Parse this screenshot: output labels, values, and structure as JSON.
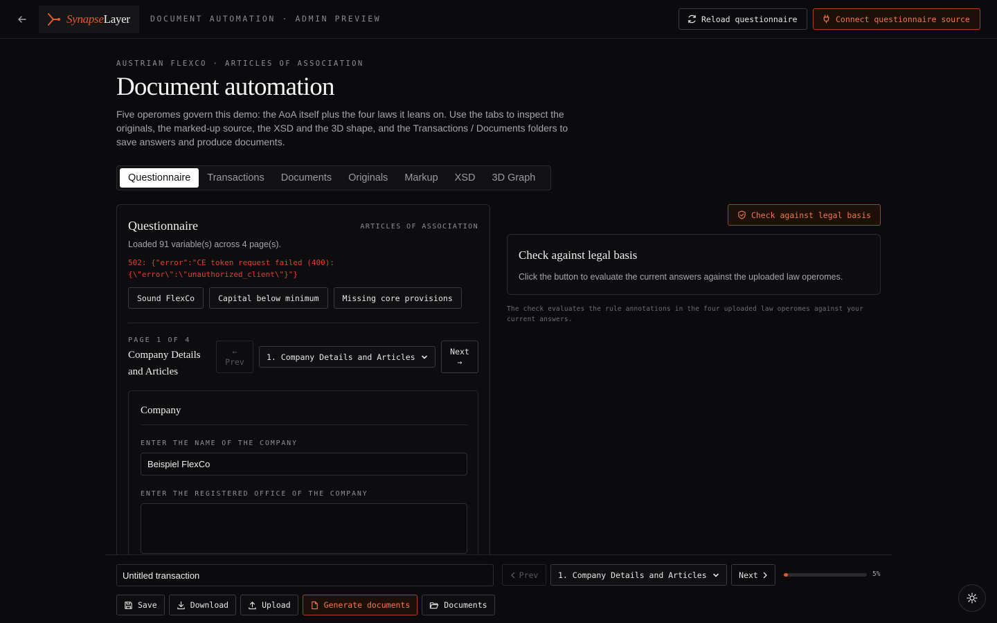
{
  "topbar": {
    "brand_accent": "Synapse",
    "brand_rest": "Layer",
    "breadcrumb": "DOCUMENT AUTOMATION · ADMIN PREVIEW",
    "reload_label": "Reload questionnaire",
    "connect_label": "Connect questionnaire source"
  },
  "header": {
    "kicker": "AUSTRIAN FLEXCO · ARTICLES OF ASSOCIATION",
    "title": "Document automation",
    "description": "Five operomes govern this demo: the AoA itself plus the four laws it leans on. Use the tabs to inspect the originals, the marked-up source, the XSD and the 3D shape, and the Transactions / Documents folders to save answers and produce documents."
  },
  "tabs": [
    {
      "label": "Questionnaire"
    },
    {
      "label": "Transactions"
    },
    {
      "label": "Documents"
    },
    {
      "label": "Originals"
    },
    {
      "label": "Markup"
    },
    {
      "label": "XSD"
    },
    {
      "label": "3D Graph"
    }
  ],
  "questionnaire": {
    "title": "Questionnaire",
    "tag": "ARTICLES OF ASSOCIATION",
    "loaded": "Loaded 91 variable(s) across 4 page(s).",
    "error": "502: {\"error\":\"CE token request failed (400): {\\\"error\\\":\\\"unauthorized_client\\\"}\"}",
    "presets": [
      {
        "label": "Sound FlexCo"
      },
      {
        "label": "Capital below minimum"
      },
      {
        "label": "Missing core provisions"
      }
    ],
    "page_label": "PAGE 1 OF 4",
    "page_name": "Company Details and Articles",
    "prev_arrow": "←",
    "prev_label": "Prev",
    "next_label": "Next",
    "next_arrow": "→",
    "page_select": "1. Company Details and Articles",
    "section": {
      "title": "Company",
      "fields": [
        {
          "label": "ENTER THE NAME OF THE COMPANY",
          "value": "Beispiel FlexCo"
        },
        {
          "label": "ENTER THE REGISTERED OFFICE OF THE COMPANY",
          "value": ""
        }
      ]
    }
  },
  "legal_check": {
    "button_label": "Check against legal basis",
    "card_title": "Check against legal basis",
    "card_desc": "Click the button to evaluate the current answers against the uploaded law operomes.",
    "note": "The check evaluates the rule annotations in the four uploaded law operomes against your current answers."
  },
  "bottombar": {
    "transaction_name": "Untitled transaction",
    "prev_label": "Prev",
    "page_select": "1. Company Details and Articles",
    "next_label": "Next",
    "progress_percent": 5,
    "progress_text": "5%",
    "actions": {
      "save": "Save",
      "download": "Download",
      "upload": "Upload",
      "generate": "Generate documents",
      "documents": "Documents"
    }
  },
  "colors": {
    "accent": "#e05a2e",
    "error": "#d9432f",
    "background": "#0b0b0d"
  }
}
